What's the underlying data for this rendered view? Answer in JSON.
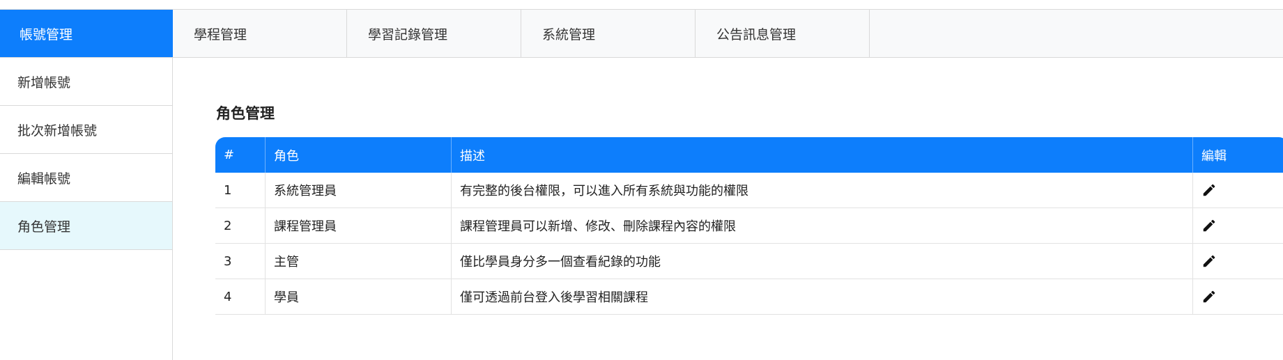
{
  "topnav": {
    "tabs": [
      {
        "label": "帳號管理",
        "active": true
      },
      {
        "label": "學程管理"
      },
      {
        "label": "學習記錄管理"
      },
      {
        "label": "系統管理"
      },
      {
        "label": "公告訊息管理"
      }
    ]
  },
  "sidebar": {
    "items": [
      {
        "label": "新增帳號"
      },
      {
        "label": "批次新增帳號"
      },
      {
        "label": "編輯帳號"
      },
      {
        "label": "角色管理",
        "active": true
      }
    ]
  },
  "main": {
    "title": "角色管理",
    "table": {
      "headers": [
        "#",
        "角色",
        "描述",
        "編輯"
      ],
      "rows": [
        {
          "num": "1",
          "role": "系統管理員",
          "desc": "有完整的後台權限，可以進入所有系統與功能的權限"
        },
        {
          "num": "2",
          "role": "課程管理員",
          "desc": "課程管理員可以新增、修改、刪除課程內容的權限"
        },
        {
          "num": "3",
          "role": "主管",
          "desc": "僅比學員身分多一個查看紀錄的功能"
        },
        {
          "num": "4",
          "role": "學員",
          "desc": "僅可透過前台登入後學習相關課程"
        }
      ]
    }
  },
  "icons": {
    "edit": "pencil-icon"
  },
  "colors": {
    "accent": "#0d7efc",
    "sidebar_active": "#e6f8fc"
  }
}
